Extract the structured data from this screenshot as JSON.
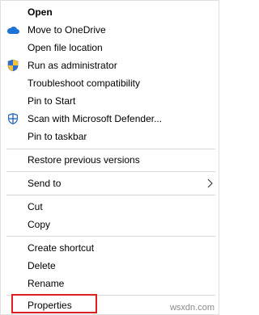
{
  "menu": {
    "items": [
      {
        "label": "Open"
      },
      {
        "label": "Move to OneDrive",
        "icon": "onedrive-cloud-icon"
      },
      {
        "label": "Open file location"
      },
      {
        "label": "Run as administrator",
        "icon": "uac-shield-icon"
      },
      {
        "label": "Troubleshoot compatibility"
      },
      {
        "label": "Pin to Start"
      },
      {
        "label": "Scan with Microsoft Defender...",
        "icon": "defender-icon"
      },
      {
        "label": "Pin to taskbar"
      },
      {
        "label": "Restore previous versions"
      },
      {
        "label": "Send to",
        "icon": "chevron-right-icon"
      },
      {
        "label": "Cut"
      },
      {
        "label": "Copy"
      },
      {
        "label": "Create shortcut"
      },
      {
        "label": "Delete"
      },
      {
        "label": "Rename"
      },
      {
        "label": "Properties"
      }
    ]
  },
  "colors": {
    "highlight_border": "#e0201f",
    "onedrive_blue": "#1e73d6",
    "separator": "#d7d7d7"
  },
  "watermark": "wsxdn.com"
}
